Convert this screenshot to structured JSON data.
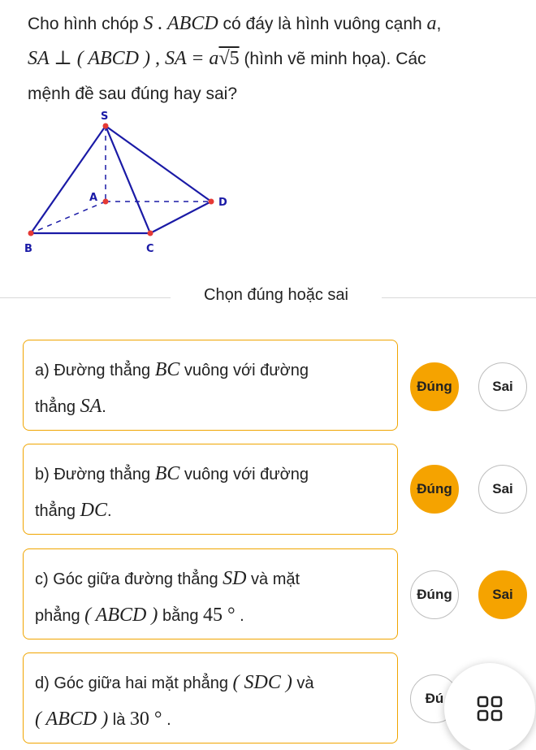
{
  "question": {
    "p1": "Cho hình chóp ",
    "m_sabcd": "S . ABCD",
    "p2": " có đáy là hình vuông cạnh ",
    "m_a": "a",
    "p3": ",",
    "m_sa_perp": "SA ⊥ ( ABCD ) , SA = a",
    "m_sqrt5": "√5",
    "p4": " (hình vẽ minh họa). Các",
    "p5": "mệnh đề sau đúng hay sai?"
  },
  "figure": {
    "labels": {
      "S": "S",
      "A": "A",
      "B": "B",
      "C": "C",
      "D": "D"
    },
    "line_color": "#1a1aa6",
    "point_color": "#e53935"
  },
  "section_title": "Chọn đúng hoặc sai",
  "accent_color": "#f5a300",
  "statements": [
    {
      "prefix": "a) Đường thẳng ",
      "m1": "BC",
      "mid": " vuông với đường",
      "line2a": "thẳng ",
      "m2": "SA",
      "tail": ".",
      "true_label": "Đúng",
      "false_label": "Sai",
      "selected": "true"
    },
    {
      "prefix": "b) Đường thẳng ",
      "m1": "BC",
      "mid": " vuông với đường",
      "line2a": "thẳng ",
      "m2": "DC",
      "tail": ".",
      "true_label": "Đúng",
      "false_label": "Sai",
      "selected": "true"
    },
    {
      "prefix": "c) Góc giữa đường thẳng ",
      "m1": "SD",
      "mid": " và mặt",
      "line2a": "phẳng ",
      "m2": "( ABCD )",
      "mid2": " bằng ",
      "m3": "45 °",
      "tail": " .",
      "true_label": "Đúng",
      "false_label": "Sai",
      "selected": "false"
    },
    {
      "prefix": "d) Góc giữa hai mặt phẳng ",
      "m1": "( SDC )",
      "mid": " và",
      "line2a": "",
      "m2": "( ABCD )",
      "mid2": " là ",
      "m3": "30 °",
      "tail": " .",
      "true_label": "Đú",
      "false_label": "",
      "selected": "none"
    }
  ],
  "floating_button": {
    "icon": "grid-icon"
  }
}
